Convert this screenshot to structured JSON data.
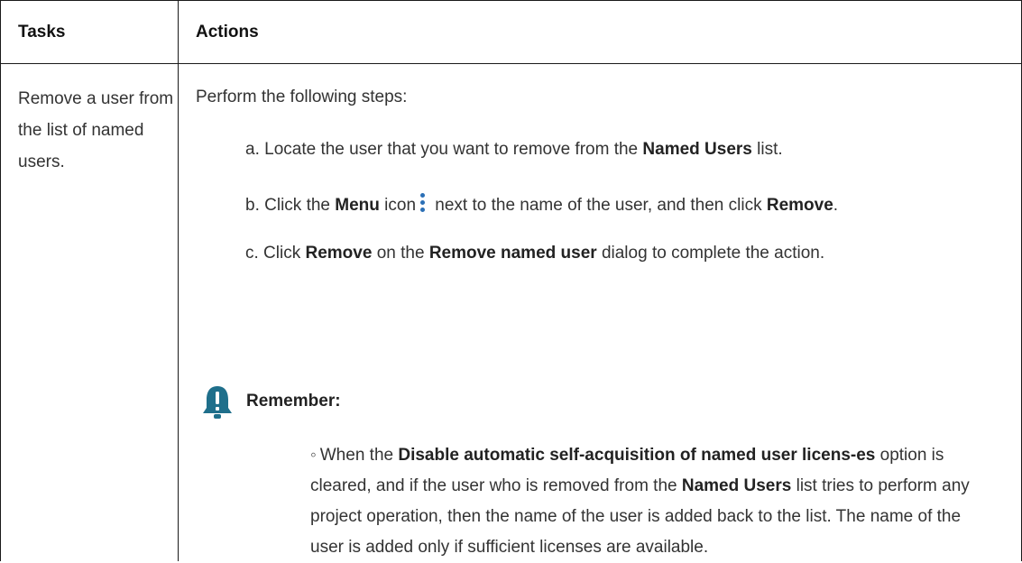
{
  "table": {
    "headers": {
      "tasks": "Tasks",
      "actions": "Actions"
    },
    "task_text": "Remove a user from the list of named users.",
    "intro": "Perform the following steps:",
    "steps": {
      "a": {
        "prefix": "a. Locate the user that you want to remove from the ",
        "bold1": "Named Users",
        "suffix": " list."
      },
      "b": {
        "prefix": "b. Click the ",
        "bold1": "Menu",
        "mid": " icon",
        "icon": "kebab-menu-icon",
        "mid2": " next to the name of the user, and then click ",
        "bold2": "Remove",
        "suffix": "."
      },
      "c": {
        "prefix": "c. Click ",
        "bold1": "Remove",
        "mid": " on the ",
        "bold2": "Remove named user",
        "suffix": " dialog to complete the action."
      }
    },
    "remember": {
      "title": "Remember:",
      "icon": "bell-notice-icon",
      "bullet_mark": "◦",
      "b_when": "When the ",
      "b_bold1": "Disable automatic self-acquisition of named user licens-es",
      "b_text1": " option is cleared, and if the user who is removed from the ",
      "b_bold2": "Named Users",
      "b_text2": " list tries to perform any project operation, then the name of the user is added back to the list. The name of the user is added only if sufficient licenses are available."
    }
  },
  "colors": {
    "border": "#1a1a1a",
    "icon_blue": "#2b6fb6",
    "bell_teal": "#1f6f8b"
  }
}
